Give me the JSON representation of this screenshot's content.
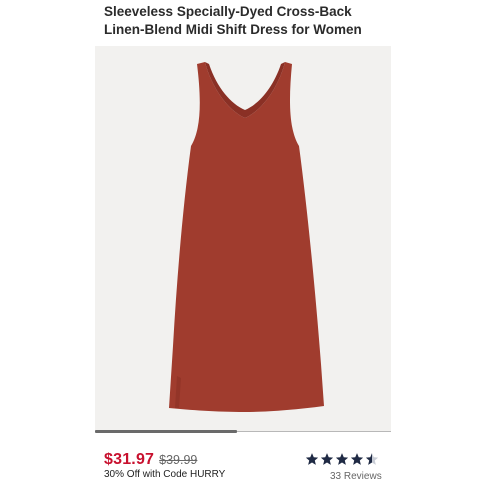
{
  "product": {
    "title_line1": "Sleeveless Specially-Dyed Cross-Back",
    "title_line2": "Linen-Blend Midi Shift Dress for Women",
    "image_alt": "Rust red sleeveless cross-back midi shift dress",
    "dress_color": "#a03c2e",
    "dress_shadow_color": "#8a3025",
    "background_color": "#f2f1ef"
  },
  "carousel": {
    "progress_fraction": 0.48
  },
  "pricing": {
    "sale_price": "$31.97",
    "original_price": "$39.99",
    "promo": "30% Off with Code HURRY",
    "sale_color": "#c8102e"
  },
  "rating": {
    "value": 4.5,
    "max": 5,
    "reviews_label": "33 Reviews",
    "star_color": "#1f2a44"
  }
}
